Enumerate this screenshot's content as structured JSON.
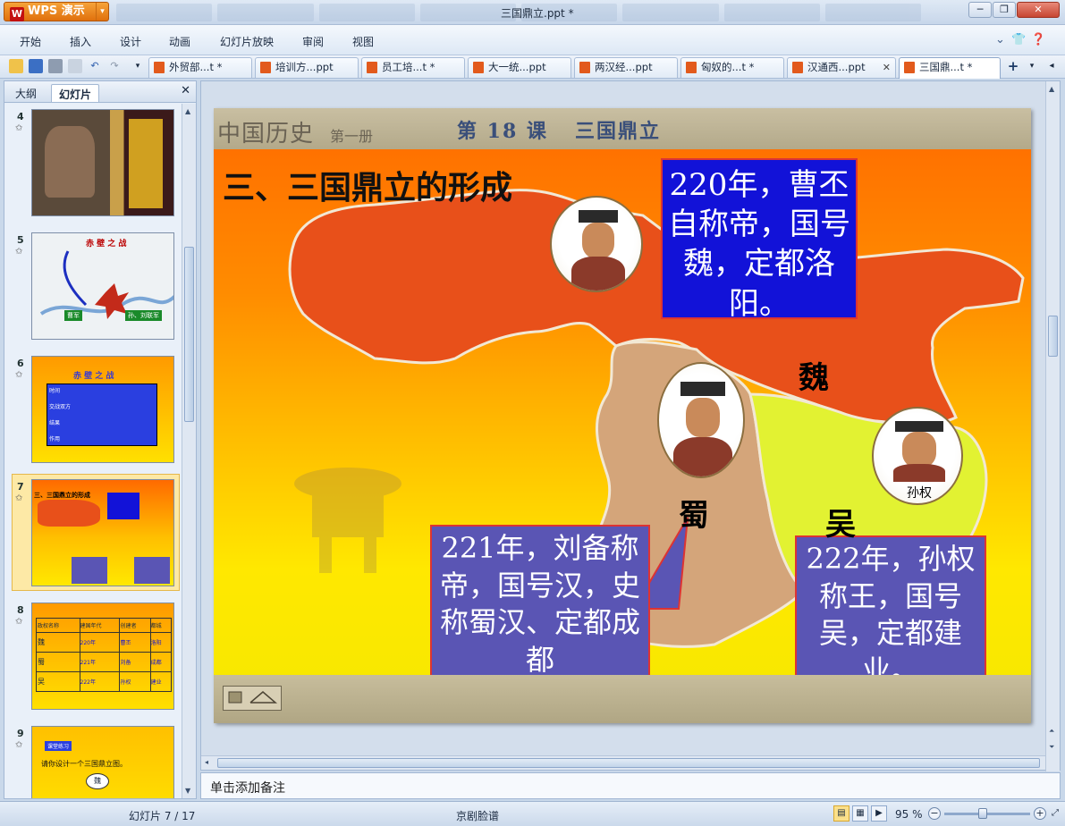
{
  "app": {
    "button_label": "WPS 演示",
    "window_title": "三国鼎立.ppt *"
  },
  "menu": [
    "开始",
    "插入",
    "设计",
    "动画",
    "幻灯片放映",
    "审阅",
    "视图"
  ],
  "tabs": [
    {
      "label": "外贸部...t *"
    },
    {
      "label": "培训方...ppt"
    },
    {
      "label": "员工培...t *"
    },
    {
      "label": "大一统...ppt"
    },
    {
      "label": "两汉经...ppt"
    },
    {
      "label": "匈奴的...t *"
    },
    {
      "label": "汉通西...ppt"
    },
    {
      "label": "三国鼎...t *"
    }
  ],
  "left_pane": {
    "tabs": [
      "大纲",
      "幻灯片"
    ],
    "thumbnails": [
      {
        "num": "4"
      },
      {
        "num": "5",
        "text": "赤 壁 之 战",
        "labels": [
          "曹军",
          "孙、刘联军"
        ]
      },
      {
        "num": "6",
        "text": "赤 壁 之 战",
        "rows": [
          "时间",
          "交战双方",
          "结果",
          "作用"
        ]
      },
      {
        "num": "7",
        "text": "三、三国鼎立的形成"
      },
      {
        "num": "8",
        "headers": [
          "政权名称",
          "建国年代",
          "创建者",
          "都城"
        ],
        "rows": [
          [
            "魏",
            "220年",
            "曹丕",
            "洛阳"
          ],
          [
            "蜀",
            "221年",
            "刘备",
            "成都"
          ],
          [
            "吴",
            "222年",
            "孙权",
            "建业"
          ]
        ]
      },
      {
        "num": "9",
        "text": "请你设计一个三国鼎立图。",
        "label": "课堂练习",
        "center": "魏"
      }
    ]
  },
  "slide": {
    "header_title": "中国历史",
    "header_sub": "第一册",
    "lesson": "第 18 课",
    "lesson_title": "三国鼎立",
    "title": "三、三国鼎立的形成",
    "box_wei": "220年，曹丕自称帝，国号魏，定都洛阳。",
    "box_shu": "221年，刘备称帝，国号汉，史称蜀汉、定都成都",
    "box_wu": "222年，孙权称王，国号吴，定都建业。",
    "kingdoms": {
      "wei": "魏",
      "shu": "蜀",
      "wu": "吴"
    },
    "portrait_caption": "孙权"
  },
  "notes": {
    "placeholder": "单击添加备注"
  },
  "status": {
    "slide_counter": "幻灯片 7 / 17",
    "template": "京剧脸谱",
    "zoom": "95 %"
  }
}
